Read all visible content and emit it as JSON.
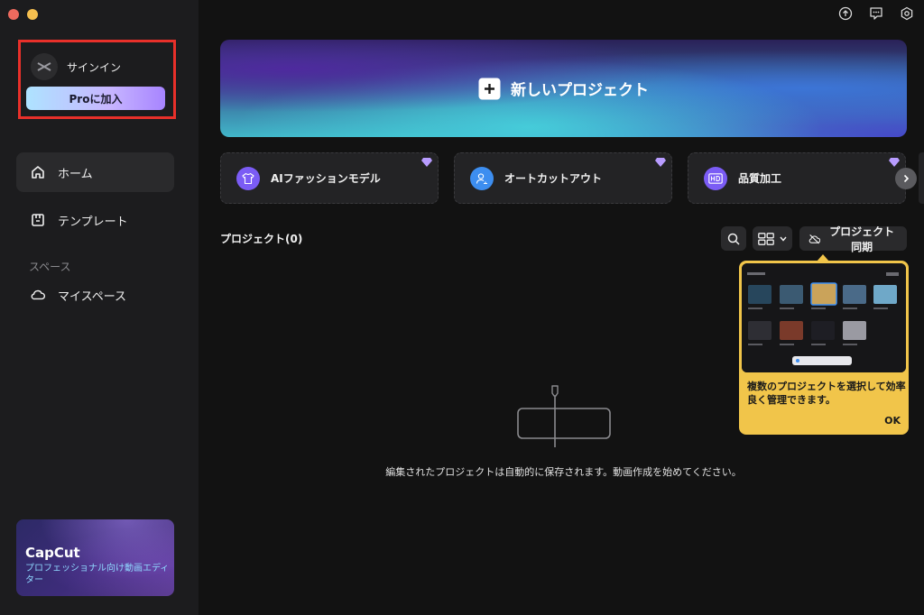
{
  "sidebar": {
    "signin_label": "サインイン",
    "pro_button": "Proに加入",
    "nav": [
      {
        "label": "ホーム",
        "icon": "home-icon",
        "active": true
      },
      {
        "label": "テンプレート",
        "icon": "template-icon",
        "active": false
      }
    ],
    "section_label": "スペース",
    "space_item": {
      "label": "マイスペース",
      "icon": "cloud-icon"
    },
    "promo": {
      "title": "CapCut",
      "subtitle": "プロフェッショナル向け動画エディター"
    }
  },
  "banner": {
    "label": "新しいプロジェクト"
  },
  "cards": [
    {
      "label": "AIファッションモデル",
      "icon": "shirt-icon",
      "color": "#7b5cf5"
    },
    {
      "label": "オートカットアウト",
      "icon": "person-cutout-icon",
      "color": "#3d8ef0"
    },
    {
      "label": "品質加工",
      "icon": "hd-icon",
      "color": "#7b5cf5"
    }
  ],
  "projects": {
    "title": "プロジェクト(0)",
    "sync_label": "プロジェクト同期",
    "empty_message": "編集されたプロジェクトは自動的に保存されます。動画作成を始めてください。"
  },
  "tooltip": {
    "text": "複数のプロジェクトを選択して効率良く管理できます。",
    "ok": "OK"
  },
  "colors": {
    "accent_yellow": "#f1c54a",
    "highlight_red": "#e8302a",
    "background": "#121212",
    "sidebar": "#1c1c1e"
  }
}
